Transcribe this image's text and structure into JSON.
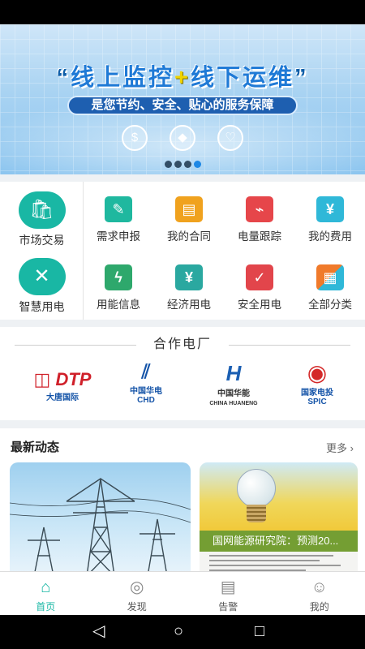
{
  "banner": {
    "title_quote_open": "“",
    "title_part1": "线上监控",
    "title_plus": "+",
    "title_part2": "线下运维",
    "title_quote_close": "”",
    "subtitle": "是您节约、安全、贴心的服务保障",
    "icons": [
      "money-bag-icon",
      "shield-icon",
      "heart-icon"
    ],
    "slide_count": 4,
    "active_slide": 4
  },
  "services": {
    "big": [
      {
        "label": "市场交易",
        "icon": "shopping-bag-icon"
      },
      {
        "label": "智慧用电",
        "icon": "network-icon"
      }
    ],
    "grid": [
      {
        "label": "需求申报",
        "icon": "pen-list-icon",
        "color": "#1fb89f",
        "glyph": "✎"
      },
      {
        "label": "我的合同",
        "icon": "document-icon",
        "color": "#f0a21e",
        "glyph": "▤"
      },
      {
        "label": "电量跟踪",
        "icon": "monitor-chart-icon",
        "color": "#e6464a",
        "glyph": "⌁"
      },
      {
        "label": "我的费用",
        "icon": "bill-yuan-icon",
        "color": "#2fb8d8",
        "glyph": "¥"
      },
      {
        "label": "用能信息",
        "icon": "lightning-icon",
        "color": "#2ea86c",
        "glyph": "⚡"
      },
      {
        "label": "经济用电",
        "icon": "yuan-cash-icon",
        "color": "#2aa8a0",
        "glyph": "¥"
      },
      {
        "label": "安全用电",
        "icon": "security-shield-icon",
        "color": "#e2454b",
        "glyph": "✓"
      },
      {
        "label": "全部分类",
        "icon": "category-grid-icon",
        "color": "#f07a2a",
        "glyph": "▦"
      }
    ]
  },
  "partners": {
    "title": "合作电厂",
    "logos": [
      {
        "name": "大唐国际",
        "mark": "DTP",
        "color": "#d0202a"
      },
      {
        "name": "中国华电 CHD",
        "mark": "//",
        "color": "#1554a8"
      },
      {
        "name": "中国华能 CHINA HUANENG",
        "mark": "H",
        "color": "#1b5fb3"
      },
      {
        "name": "国家电投 SPIC",
        "mark": "◉",
        "color": "#d42a2a"
      }
    ]
  },
  "news": {
    "title": "最新动态",
    "more": "更多",
    "card2_caption": "国网能源研究院：预测20..."
  },
  "tabbar": {
    "tabs": [
      {
        "label": "首页",
        "icon": "home-icon",
        "glyph": "⌂",
        "active": true
      },
      {
        "label": "发现",
        "icon": "compass-icon",
        "glyph": "◎",
        "active": false
      },
      {
        "label": "告警",
        "icon": "alarm-document-icon",
        "glyph": "▤",
        "active": false
      },
      {
        "label": "我的",
        "icon": "user-icon",
        "glyph": "☺",
        "active": false
      }
    ]
  },
  "navbar": {
    "back": "◁",
    "home": "○",
    "recents": "□"
  }
}
